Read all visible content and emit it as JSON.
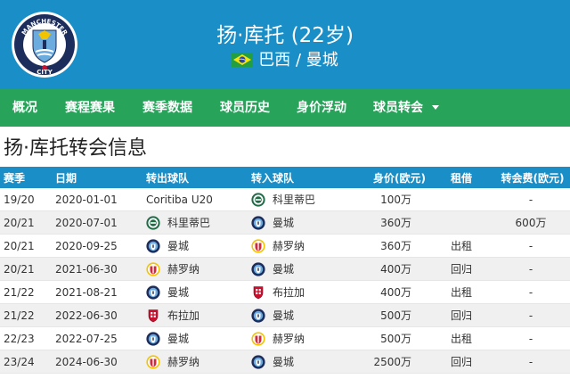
{
  "header": {
    "club_logo_icon": "manchester-city-crest-icon",
    "club_logo_text_top": "MANCHESTER",
    "club_logo_text_bottom": "CITY",
    "player_title": "扬·库托 (22岁)",
    "nationality_flag_icon": "brazil-flag-icon",
    "nationality": "巴西",
    "separator": "/",
    "club": "曼城"
  },
  "nav": {
    "items": [
      {
        "label": "概况"
      },
      {
        "label": "赛程赛果"
      },
      {
        "label": "赛季数据"
      },
      {
        "label": "球员历史"
      },
      {
        "label": "身价浮动"
      },
      {
        "label": "球员转会"
      }
    ],
    "dropdown_icon": "caret-down-icon"
  },
  "section": {
    "title": "扬·库托转会信息"
  },
  "table": {
    "headers": {
      "season": "赛季",
      "date": "日期",
      "from_club": "转出球队",
      "to_club": "转入球队",
      "value": "身价(欧元)",
      "loan": "租借",
      "fee": "转会费(欧元)"
    },
    "rows": [
      {
        "season": "19/20",
        "date": "2020-01-01",
        "from": "Coritiba U20",
        "from_badge": "",
        "to": "科里蒂巴",
        "to_badge": "coritiba-badge-icon",
        "value": "100万",
        "loan": "",
        "fee": "-"
      },
      {
        "season": "20/21",
        "date": "2020-07-01",
        "from": "科里蒂巴",
        "from_badge": "coritiba-badge-icon",
        "to": "曼城",
        "to_badge": "manchester-city-badge-icon",
        "value": "360万",
        "loan": "",
        "fee": "600万"
      },
      {
        "season": "20/21",
        "date": "2020-09-25",
        "from": "曼城",
        "from_badge": "manchester-city-badge-icon",
        "to": "赫罗纳",
        "to_badge": "girona-badge-icon",
        "value": "360万",
        "loan": "出租",
        "fee": "-"
      },
      {
        "season": "20/21",
        "date": "2021-06-30",
        "from": "赫罗纳",
        "from_badge": "girona-badge-icon",
        "to": "曼城",
        "to_badge": "manchester-city-badge-icon",
        "value": "400万",
        "loan": "回归",
        "fee": "-"
      },
      {
        "season": "21/22",
        "date": "2021-08-21",
        "from": "曼城",
        "from_badge": "manchester-city-badge-icon",
        "to": "布拉加",
        "to_badge": "braga-badge-icon",
        "value": "400万",
        "loan": "出租",
        "fee": "-"
      },
      {
        "season": "21/22",
        "date": "2022-06-30",
        "from": "布拉加",
        "from_badge": "braga-badge-icon",
        "to": "曼城",
        "to_badge": "manchester-city-badge-icon",
        "value": "500万",
        "loan": "回归",
        "fee": "-"
      },
      {
        "season": "22/23",
        "date": "2022-07-25",
        "from": "曼城",
        "from_badge": "manchester-city-badge-icon",
        "to": "赫罗纳",
        "to_badge": "girona-badge-icon",
        "value": "500万",
        "loan": "出租",
        "fee": "-"
      },
      {
        "season": "23/24",
        "date": "2024-06-30",
        "from": "赫罗纳",
        "from_badge": "girona-badge-icon",
        "to": "曼城",
        "to_badge": "manchester-city-badge-icon",
        "value": "2500万",
        "loan": "回归",
        "fee": "-"
      }
    ]
  },
  "colors": {
    "header_blue": "#1a8ec7",
    "nav_green": "#27a35a",
    "row_alt": "#f0f0f0",
    "city_sky": "#6cabdd",
    "girona_red": "#d6283a",
    "coritiba_green": "#1f6b45",
    "braga_red": "#c8102e"
  }
}
